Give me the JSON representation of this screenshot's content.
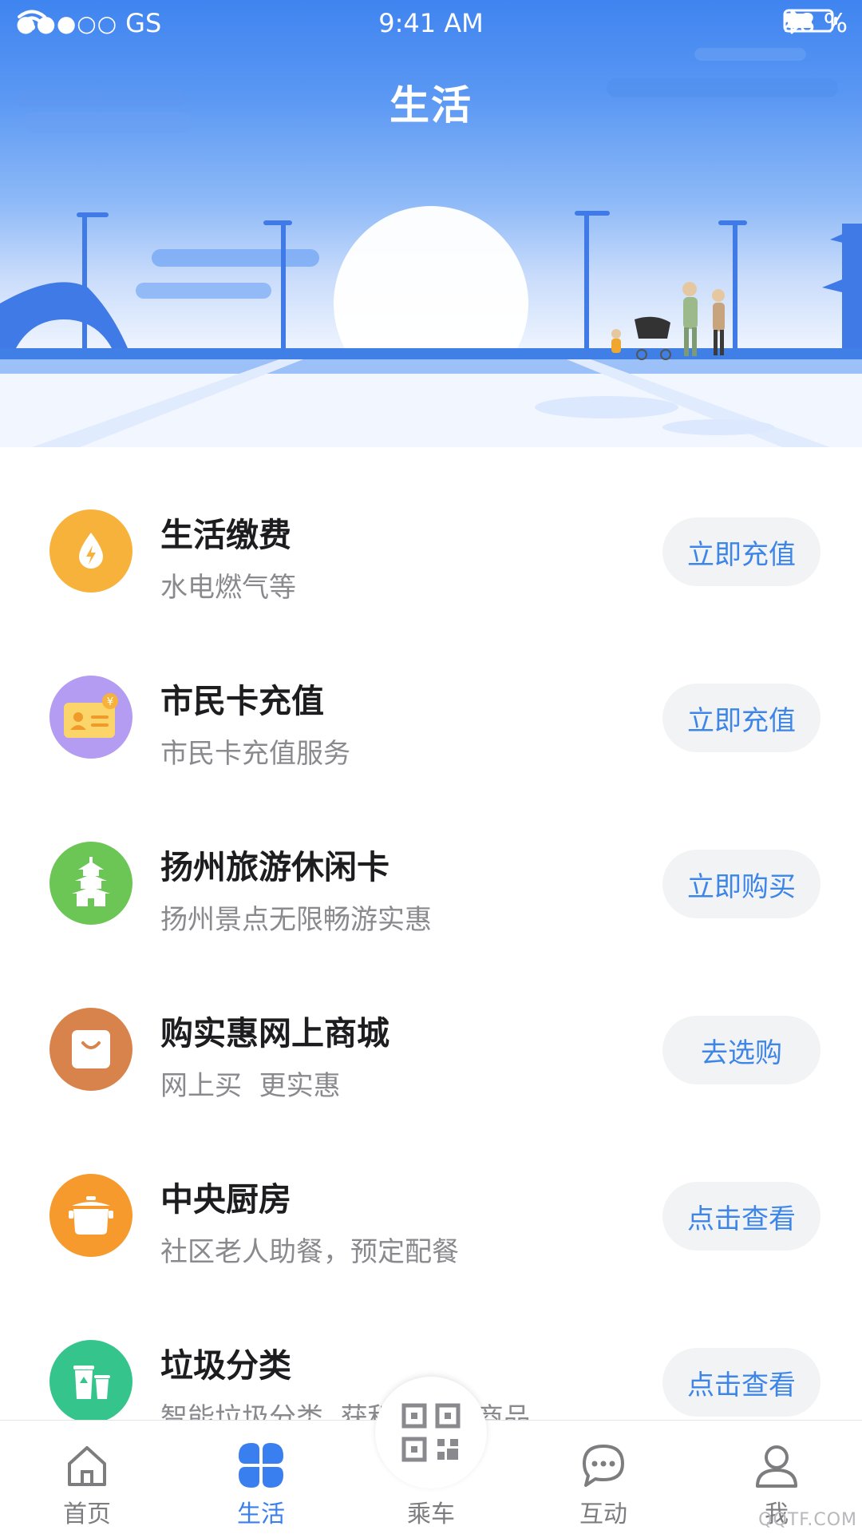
{
  "status_bar": {
    "signal": "●●●○○",
    "carrier": "GS",
    "time": "9:41 AM",
    "battery_percent": "58 %",
    "battery_level": 0.58
  },
  "header": {
    "title": "生活"
  },
  "services": [
    {
      "title": "生活缴费",
      "subtitle": "水电燃气等",
      "button": "立即充值",
      "icon": "water-drop-bolt-icon",
      "color": "#f7b23b"
    },
    {
      "title": "市民卡充值",
      "subtitle": "市民卡充值服务",
      "button": "立即充值",
      "icon": "citizen-card-icon",
      "color": "#b49cf2"
    },
    {
      "title": "扬州旅游休闲卡",
      "subtitle": "扬州景点无限畅游实惠",
      "button": "立即购买",
      "icon": "pagoda-icon",
      "color": "#6cc655"
    },
    {
      "title": "购实惠网上商城",
      "subtitle": "网上买  更实惠",
      "button": "去选购",
      "icon": "shopping-bag-icon",
      "color": "#d9834c"
    },
    {
      "title": "中央厨房",
      "subtitle": "社区老人助餐，预定配餐",
      "button": "点击查看",
      "icon": "cooking-pot-icon",
      "color": "#f79a2d"
    },
    {
      "title": "垃圾分类",
      "subtitle": "智能垃圾分类  获积分兑换商品",
      "button": "点击查看",
      "icon": "recycle-bin-icon",
      "color": "#34c48c"
    }
  ],
  "tabbar": {
    "tabs": [
      {
        "label": "首页",
        "icon": "home-icon"
      },
      {
        "label": "生活",
        "icon": "clover-icon"
      },
      {
        "label": "乘车",
        "icon": "qr-code-icon"
      },
      {
        "label": "互动",
        "icon": "chat-bubble-icon"
      },
      {
        "label": "我",
        "icon": "person-icon"
      }
    ],
    "active": "生活"
  },
  "watermark": "QQTF.COM",
  "colors": {
    "accent": "#3a7ff0",
    "button_text": "#3d86e8",
    "button_bg": "#f2f3f5"
  }
}
